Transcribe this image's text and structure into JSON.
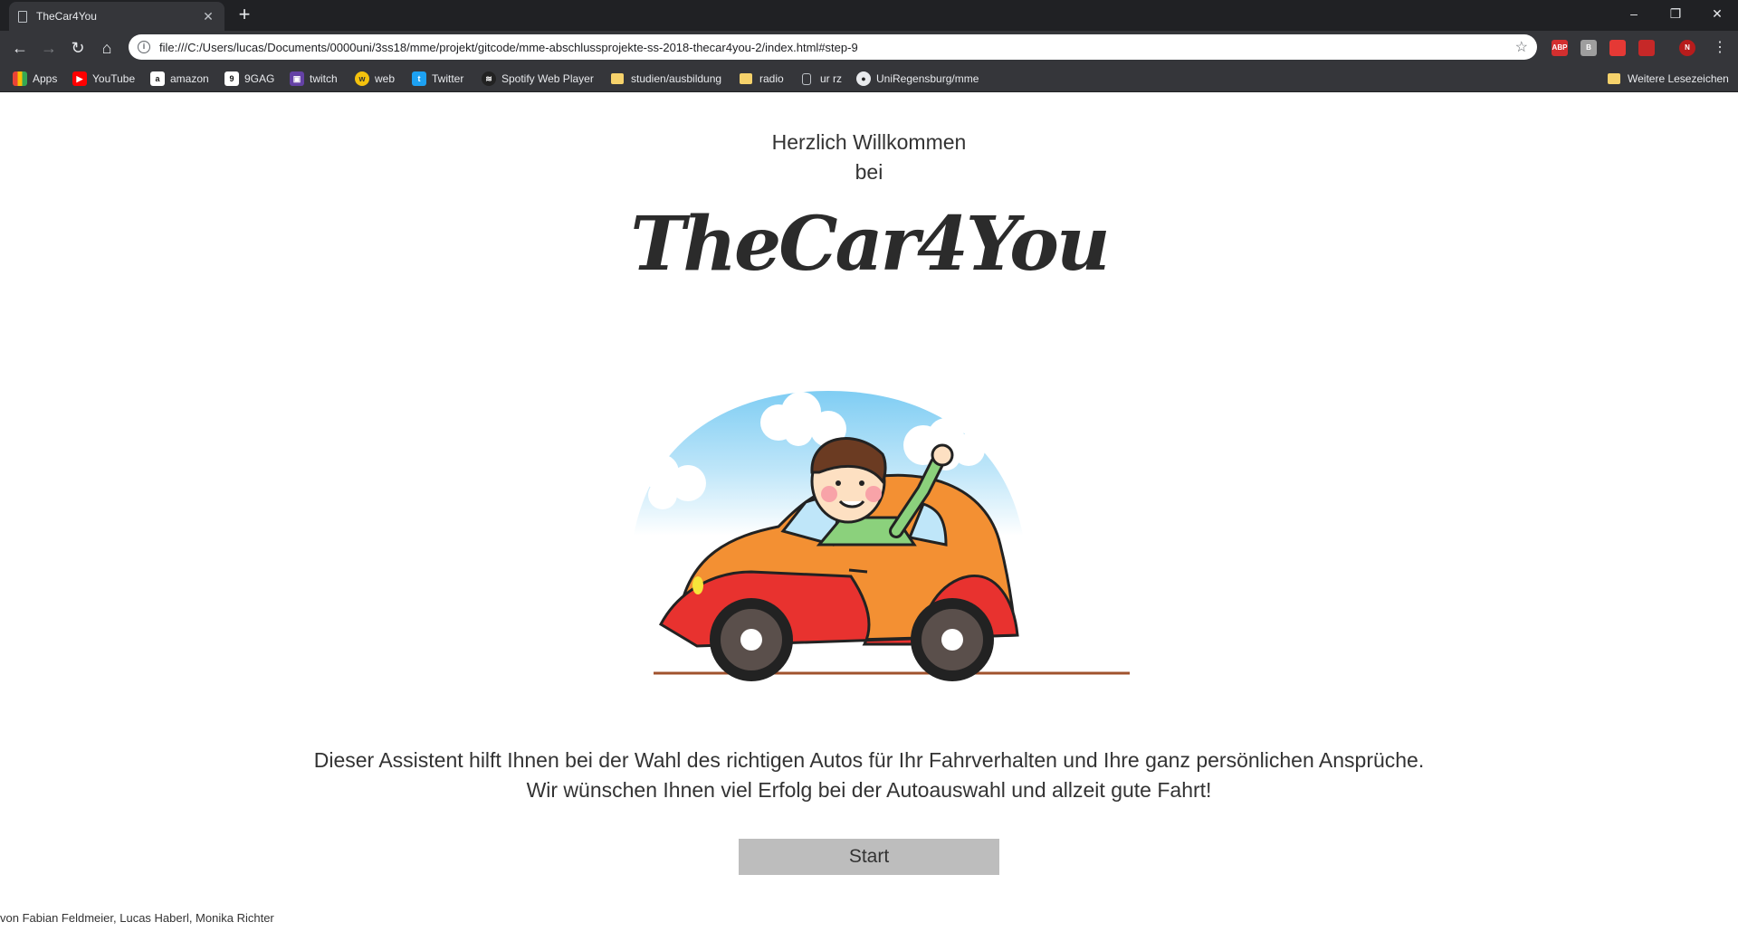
{
  "browser": {
    "tab_title": "TheCar4You",
    "url": "file:///C:/Users/lucas/Documents/0000uni/3ss18/mme/projekt/gitcode/mme-abschlussprojekte-ss-2018-thecar4you-2/index.html#step-9",
    "bookmarks": [
      "Apps",
      "YouTube",
      "amazon",
      "9GAG",
      "twitch",
      "web",
      "Twitter",
      "Spotify Web Player",
      "studien/ausbildung",
      "radio",
      "ur rz",
      "UniRegensburg/mme"
    ],
    "other_bookmarks": "Weitere Lesezeichen",
    "extensions": [
      "ABP",
      "B",
      "",
      "",
      "N"
    ]
  },
  "page": {
    "welcome_line1": "Herzlich Willkommen",
    "welcome_line2": "bei",
    "brand": "TheCar4You",
    "desc_line1": "Dieser Assistent hilft Ihnen bei der Wahl des richtigen Autos für Ihr Fahrverhalten und Ihre ganz persönlichen Ansprüche.",
    "desc_line2": "Wir wünschen Ihnen viel Erfolg bei der Autoauswahl und allzeit gute Fahrt!",
    "start_label": "Start",
    "credits": "von Fabian Feldmeier, Lucas Haberl, Monika Richter"
  },
  "colors": {
    "start_button": "#bdbdbd",
    "car_body": "#f39033",
    "car_fender": "#e8322f",
    "sky": "#8fd3f5"
  }
}
